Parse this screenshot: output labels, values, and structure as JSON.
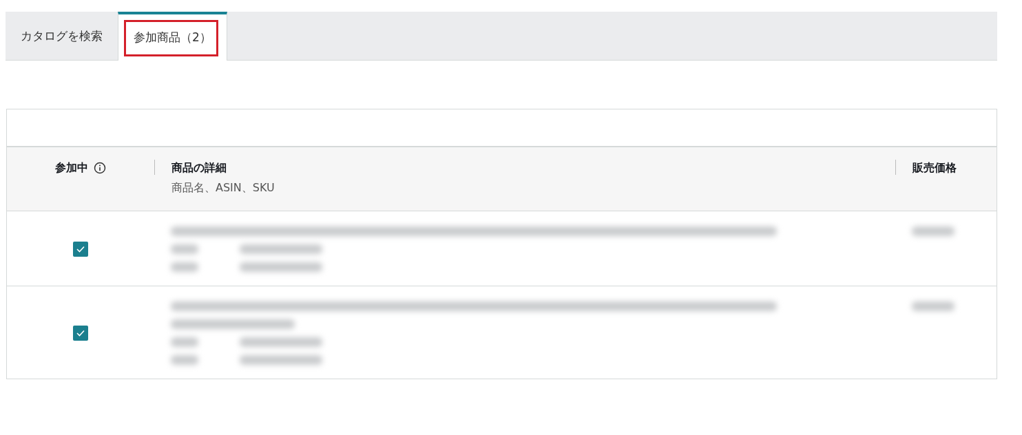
{
  "tabs": [
    {
      "label": "カタログを検索",
      "selected": false,
      "highlighted": false
    },
    {
      "label": "参加商品（2）",
      "selected": true,
      "highlighted": true
    }
  ],
  "table": {
    "columns": [
      {
        "label": "参加中",
        "info": true
      },
      {
        "label": "商品の詳細",
        "sublabel": "商品名、ASIN、SKU"
      },
      {
        "label": "販売価格"
      }
    ],
    "rows": [
      {
        "checked": true,
        "detail_lines": [
          {
            "kind": "title"
          },
          {
            "kind": "pair"
          },
          {
            "kind": "pair"
          }
        ]
      },
      {
        "checked": true,
        "detail_lines": [
          {
            "kind": "title"
          },
          {
            "kind": "short"
          },
          {
            "kind": "pair"
          },
          {
            "kind": "pair"
          }
        ]
      }
    ]
  }
}
